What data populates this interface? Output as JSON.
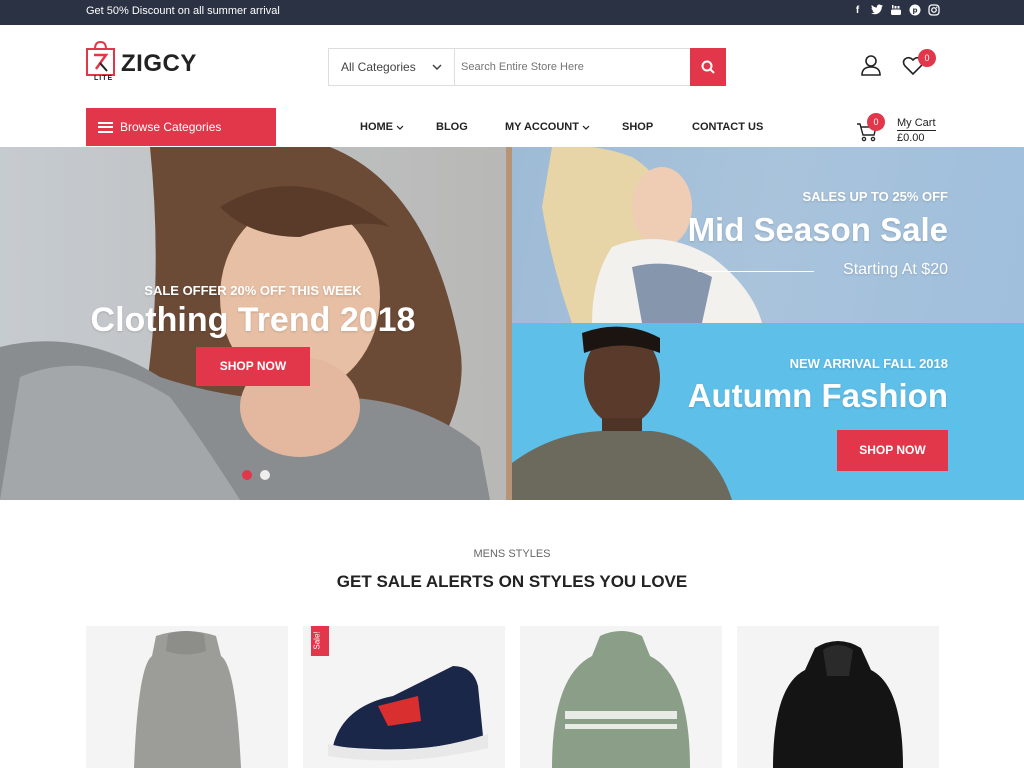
{
  "topbar": {
    "promo_text": "Get 50% Discount on all summer arrival",
    "social": [
      "facebook-icon",
      "twitter-icon",
      "youtube-icon",
      "pinterest-icon",
      "instagram-icon"
    ]
  },
  "brand": {
    "name": "ZIGCY",
    "tag": "LITE",
    "accent": "#e2364b"
  },
  "search": {
    "category": "All Categories",
    "placeholder": "Search Entire Store Here"
  },
  "header": {
    "wishlist_count": "0"
  },
  "nav": {
    "browse_label": "Browse Categories",
    "items": [
      {
        "label": "HOME",
        "dropdown": true
      },
      {
        "label": "BLOG",
        "dropdown": false
      },
      {
        "label": "MY ACCOUNT",
        "dropdown": true
      },
      {
        "label": "SHOP",
        "dropdown": false
      },
      {
        "label": "CONTACT US",
        "dropdown": false
      }
    ],
    "cart": {
      "count": "0",
      "label": "My Cart",
      "amount": "£0.00"
    }
  },
  "hero": {
    "subtitle": "SALE OFFER 20% OFF THIS WEEK",
    "title": "Clothing Trend 2018",
    "button": "SHOP NOW",
    "active_slide": 1,
    "slides": 2
  },
  "promo_a": {
    "subtitle": "SALES UP TO 25% OFF",
    "title": "Mid Season Sale",
    "tagline": "Starting At $20"
  },
  "promo_b": {
    "subtitle": "NEW ARRIVAL FALL 2018",
    "title": "Autumn Fashion",
    "button": "SHOP NOW"
  },
  "section": {
    "subtitle": "MENS STYLES",
    "title": "GET SALE ALERTS ON STYLES YOU LOVE"
  },
  "products": [
    {
      "name": "grey-knit-turtleneck",
      "badge": ""
    },
    {
      "name": "navy-sneaker",
      "badge": "Sale!"
    },
    {
      "name": "green-usa-hoodie",
      "badge": ""
    },
    {
      "name": "black-hoodie",
      "badge": ""
    }
  ]
}
